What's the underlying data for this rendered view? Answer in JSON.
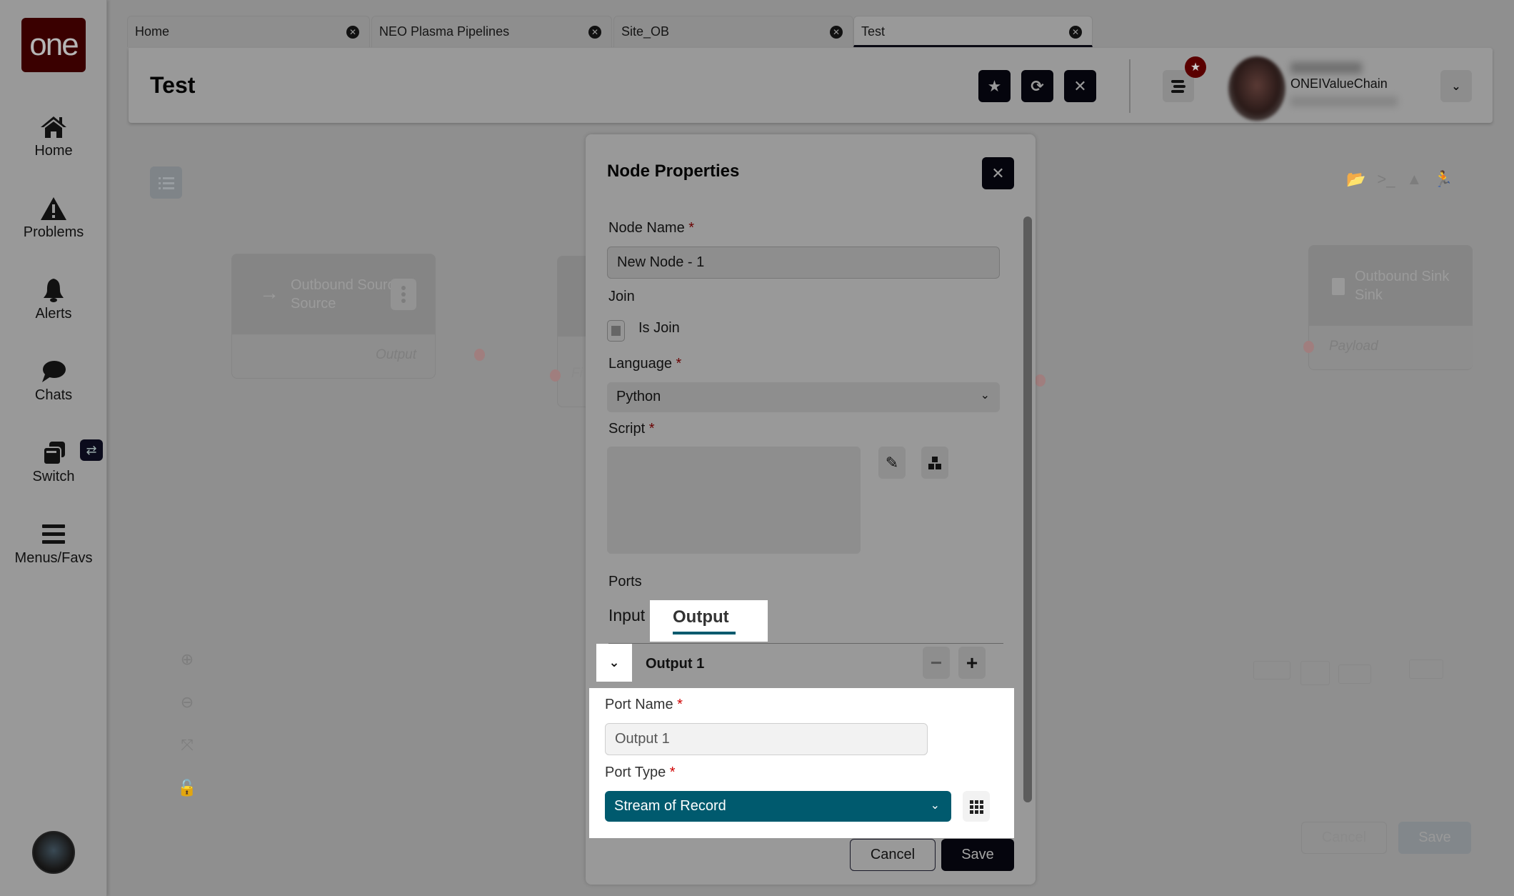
{
  "sidebar": {
    "logo_text": "one",
    "items": [
      {
        "label": "Home",
        "icon": "home-icon"
      },
      {
        "label": "Problems",
        "icon": "warning-icon"
      },
      {
        "label": "Alerts",
        "icon": "bell-icon"
      },
      {
        "label": "Chats",
        "icon": "chat-icon"
      },
      {
        "label": "Switch",
        "icon": "switch-icon"
      },
      {
        "label": "Menus/Favs",
        "icon": "hamburger-icon"
      }
    ],
    "switch_badge": "⇄"
  },
  "tabs": [
    {
      "label": "Home",
      "active": false
    },
    {
      "label": "NEO Plasma Pipelines",
      "active": false
    },
    {
      "label": "Site_OB",
      "active": false
    },
    {
      "label": "Test",
      "active": true
    }
  ],
  "header": {
    "title": "Test",
    "user_org": "ONEIValueChain"
  },
  "canvas": {
    "nodes": [
      {
        "title_line1": "Outbound Source",
        "title_line2": "Source",
        "port": "Output"
      },
      {
        "port": "Fi"
      },
      {
        "title_line1": "Outbound Sink",
        "title_line2": "Sink",
        "port": "Payload"
      }
    ],
    "cancel_label": "Cancel",
    "save_label": "Save"
  },
  "dialog": {
    "title": "Node Properties",
    "node_name_label": "Node Name",
    "node_name_value": "New Node - 1",
    "join_label": "Join",
    "is_join_label": "Is Join",
    "is_join_checked": false,
    "language_label": "Language",
    "language_value": "Python",
    "script_label": "Script",
    "script_value": "",
    "ports_label": "Ports",
    "ports_tabs": [
      "Input",
      "Output"
    ],
    "active_ports_tab": "Output",
    "port_row_label": "Output 1",
    "port_name_label": "Port Name",
    "port_name_value": "Output 1",
    "port_type_label": "Port Type",
    "port_type_value": "Stream of Record",
    "required_mark": "*",
    "cancel_label": "Cancel",
    "save_label": "Save"
  },
  "colors": {
    "brand": "#3a0000",
    "accent_teal": "#005a6e",
    "dark_button": "#05050d",
    "required": "#d00000"
  }
}
